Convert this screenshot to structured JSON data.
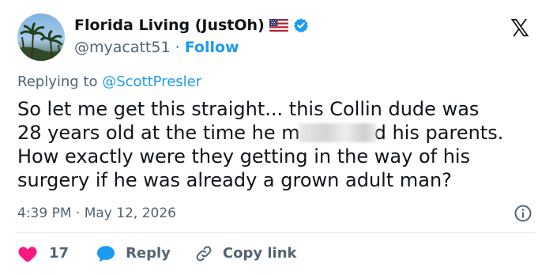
{
  "author": {
    "name": "Florida Living (JustOh)",
    "flag_icon": "us-flag-icon",
    "verified_icon": "verified-badge-icon",
    "handle": "@myacatt51",
    "separator": "·",
    "follow_label": "Follow"
  },
  "platform_icon": "x-logo-icon",
  "platform_glyph": "𝕏",
  "reply_context": {
    "prefix": "Replying to",
    "mention": "@ScottPresler"
  },
  "tweet": {
    "line1": "So let me get this straight... this Collin dude was",
    "line2_before": "28 years old at the time he m",
    "line2_after": "d his parents.",
    "line3": "How exactly were they getting in the way of his",
    "line4": "surgery if he was already a grown adult man?"
  },
  "timestamp": "4:39 PM · May 12, 2026",
  "actions": {
    "like_count": "17",
    "reply_label": "Reply",
    "copy_link_label": "Copy link"
  },
  "colors": {
    "accent": "#1d9bf0",
    "like": "#f91880",
    "muted": "#536471",
    "text": "#0f1419"
  }
}
